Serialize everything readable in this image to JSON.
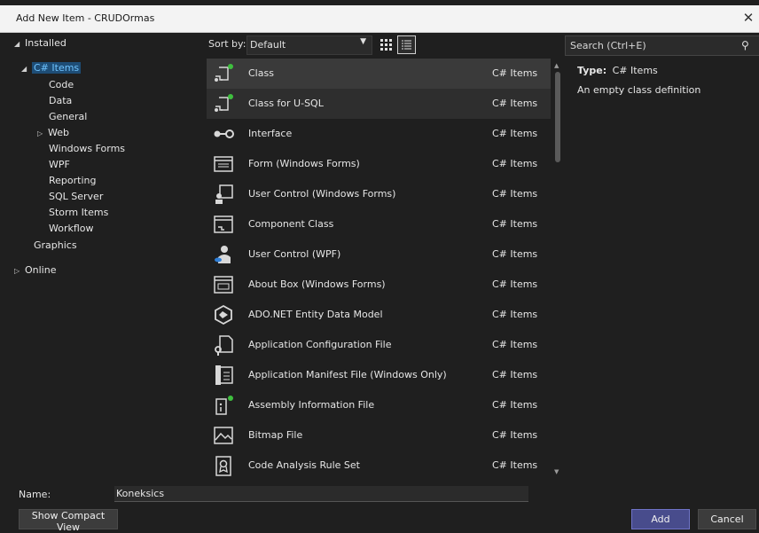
{
  "window": {
    "title": "Add New Item - CRUDOrmas",
    "close_glyph": "✕"
  },
  "tree": {
    "installed": "Installed",
    "csharp_items": "C# Items",
    "children": [
      "Code",
      "Data",
      "General",
      "Web",
      "Windows Forms",
      "WPF",
      "Reporting",
      "SQL Server",
      "Storm Items",
      "Workflow"
    ],
    "graphics": "Graphics",
    "online": "Online"
  },
  "sort": {
    "label": "Sort by:",
    "value": "Default"
  },
  "search": {
    "placeholder": "Search (Ctrl+E)"
  },
  "details": {
    "type_label": "Type:",
    "type_value": "C# Items",
    "description": "An empty class definition"
  },
  "templates": [
    {
      "name": "Class",
      "category": "C# Items",
      "icon": "class-icon",
      "selected": true
    },
    {
      "name": "Class for U-SQL",
      "category": "C# Items",
      "icon": "class-usql-icon",
      "hover": true
    },
    {
      "name": "Interface",
      "category": "C# Items",
      "icon": "interface-icon"
    },
    {
      "name": "Form (Windows Forms)",
      "category": "C# Items",
      "icon": "form-icon"
    },
    {
      "name": "User Control (Windows Forms)",
      "category": "C# Items",
      "icon": "user-control-icon"
    },
    {
      "name": "Component Class",
      "category": "C# Items",
      "icon": "component-class-icon"
    },
    {
      "name": "User Control (WPF)",
      "category": "C# Items",
      "icon": "user-control-wpf-icon"
    },
    {
      "name": "About Box (Windows Forms)",
      "category": "C# Items",
      "icon": "about-box-icon"
    },
    {
      "name": "ADO.NET Entity Data Model",
      "category": "C# Items",
      "icon": "entity-data-model-icon"
    },
    {
      "name": "Application Configuration File",
      "category": "C# Items",
      "icon": "config-file-icon"
    },
    {
      "name": "Application Manifest File (Windows Only)",
      "category": "C# Items",
      "icon": "manifest-file-icon"
    },
    {
      "name": "Assembly Information File",
      "category": "C# Items",
      "icon": "assembly-info-icon"
    },
    {
      "name": "Bitmap File",
      "category": "C# Items",
      "icon": "bitmap-file-icon"
    },
    {
      "name": "Code Analysis Rule Set",
      "category": "C# Items",
      "icon": "rule-set-icon"
    }
  ],
  "name_field": {
    "label": "Name:",
    "value": "Koneksics"
  },
  "buttons": {
    "compact": "Show Compact View",
    "add": "Add",
    "cancel": "Cancel"
  },
  "colors": {
    "accent": "#484c8c",
    "selected_tree": "#6fc3ff",
    "badge_green": "#3fbf3f"
  }
}
